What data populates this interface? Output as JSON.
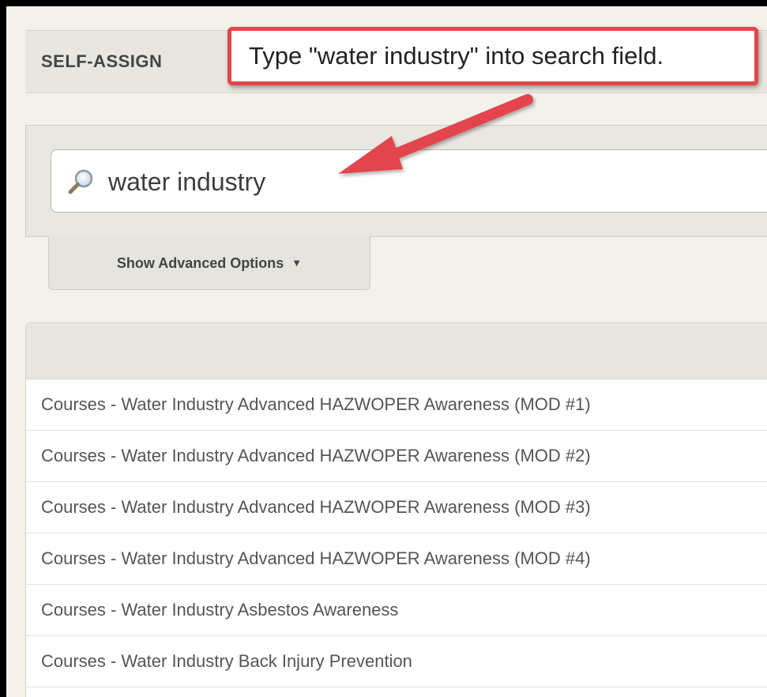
{
  "header": {
    "title": "SELF-ASSIGN"
  },
  "annotation": {
    "text": "Type \"water industry\" into search field.",
    "color": "#e2454b"
  },
  "search": {
    "value": "water industry",
    "icon": "magnifier-icon"
  },
  "advanced": {
    "label": "Show Advanced Options",
    "caret": "▼"
  },
  "results": [
    {
      "label": "Courses - Water Industry Advanced HAZWOPER Awareness (MOD #1)"
    },
    {
      "label": "Courses - Water Industry Advanced HAZWOPER Awareness (MOD #2)"
    },
    {
      "label": "Courses - Water Industry Advanced HAZWOPER Awareness (MOD #3)"
    },
    {
      "label": "Courses - Water Industry Advanced HAZWOPER Awareness (MOD #4)"
    },
    {
      "label": "Courses - Water Industry Asbestos Awareness"
    },
    {
      "label": "Courses - Water Industry Back Injury Prevention"
    }
  ]
}
